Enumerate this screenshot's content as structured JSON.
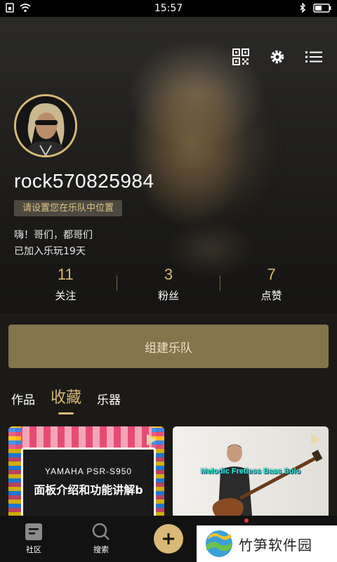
{
  "status_bar": {
    "time": "15:57"
  },
  "profile": {
    "username": "rock570825984",
    "position_tag": "请设置您在乐队中位置",
    "bio": "嗨！哥们，都哥们",
    "joined": "已加入乐玩19天"
  },
  "stats": [
    {
      "value": "11",
      "label": "关注"
    },
    {
      "value": "3",
      "label": "粉丝"
    },
    {
      "value": "7",
      "label": "点赞"
    }
  ],
  "form_band_button": "组建乐队",
  "tabs": [
    {
      "label": "作品",
      "active": false
    },
    {
      "label": "收藏",
      "active": true
    },
    {
      "label": "乐器",
      "active": false
    }
  ],
  "cards": [
    {
      "line1": "YAMAHA PSR-S950",
      "line2": "面板介绍和功能讲解b"
    },
    {
      "caption": "Melodic Fretless Bass Solo"
    }
  ],
  "nav": [
    {
      "label": "社区"
    },
    {
      "label": "搜索"
    }
  ],
  "watermark": "竹笋软件园",
  "colors": {
    "accent": "#d9b975",
    "button_bg": "#84744c",
    "page_bg": "#1c1a17"
  }
}
